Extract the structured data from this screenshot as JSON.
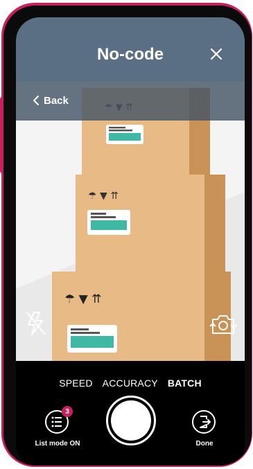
{
  "header": {
    "title": "No-code",
    "close_icon": "close-icon"
  },
  "camera": {
    "back_label": "Back",
    "back_icon": "chevron-left-icon",
    "flash_icon": "flash-off-icon",
    "switch_camera_icon": "switch-camera-icon",
    "scene": "stacked-cardboard-boxes-with-barcodes"
  },
  "modes": {
    "items": [
      {
        "label": "SPEED",
        "active": false
      },
      {
        "label": "ACCURACY",
        "active": false
      },
      {
        "label": "BATCH",
        "active": true
      }
    ]
  },
  "controls": {
    "list_mode_label": "List mode ON",
    "list_count": "3",
    "done_label": "Done"
  },
  "colors": {
    "header": "#5a6e84",
    "accent": "#c8205f",
    "box": "#e8bb86",
    "barcode": "#3fb8a4"
  }
}
